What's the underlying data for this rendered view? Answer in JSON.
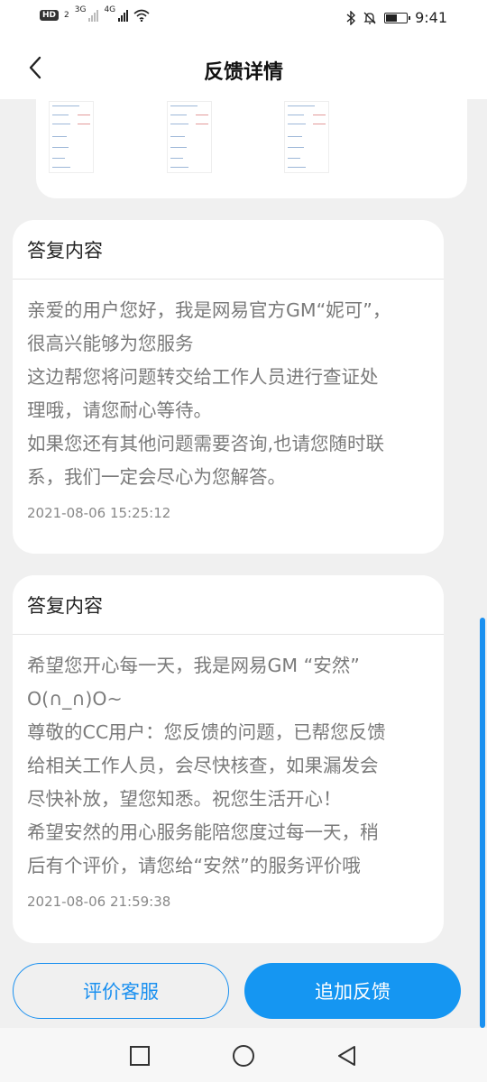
{
  "status_bar": {
    "hd_badge": "HD",
    "sim_number": "2",
    "network_1": "3G",
    "network_2": "4G",
    "time": "9:41",
    "battery_level": 0.5
  },
  "header": {
    "title": "反馈详情"
  },
  "replies": [
    {
      "heading": "答复内容",
      "lines": [
        "亲爱的用户您好，我是网易官方GM“妮可”，",
        "很高兴能够为您服务",
        "这边帮您将问题转交给工作人员进行查证处",
        "理哦，请您耐心等待。",
        "如果您还有其他问题需要咨询,也请您随时联",
        "系，我们一定会尽心为您解答。"
      ],
      "timestamp": "2021-08-06 15:25:12"
    },
    {
      "heading": "答复内容",
      "lines": [
        "希望您开心每一天，我是网易GM “安然”",
        "O(∩_∩)O~",
        "尊敬的CC用户：您反馈的问题，已帮您反馈",
        "给相关工作人员，会尽快核查，如果漏发会",
        "尽快补放，望您知悉。祝您生活开心！",
        "希望安然的用心服务能陪您度过每一天，稍",
        "后有个评价，请您给“安然”的服务评价哦"
      ],
      "timestamp": "2021-08-06 21:59:38"
    }
  ],
  "actions": {
    "rate_label": "评价客服",
    "add_feedback_label": "追加反馈"
  },
  "colors": {
    "accent": "#1596f2",
    "background": "#f0f0f0"
  },
  "icons": {
    "back": "chevron-left-icon",
    "nav_recent": "square-icon",
    "nav_home": "circle-icon",
    "nav_back": "triangle-back-icon"
  }
}
